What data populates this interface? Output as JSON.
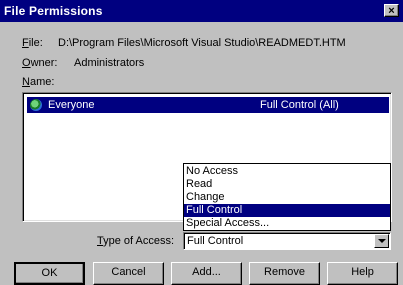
{
  "window": {
    "title": "File Permissions",
    "close_glyph": "×"
  },
  "file": {
    "label_accel": "F",
    "label_rest": "ile:",
    "value": "D:\\Program Files\\Microsoft Visual Studio\\READMEDT.HTM"
  },
  "owner": {
    "label_accel": "O",
    "label_rest": "wner:",
    "value": "Administrators"
  },
  "name": {
    "label_accel": "N",
    "label_rest": "ame:"
  },
  "permissions_list": [
    {
      "name": "Everyone",
      "permission": "Full Control (All)",
      "icon": "globe-icon",
      "selected": true
    }
  ],
  "type_of_access": {
    "label_accel": "T",
    "label_rest": "ype of Access:",
    "selected": "Full Control",
    "options": [
      "No Access",
      "Read",
      "Change",
      "Full Control",
      "Special Access..."
    ],
    "selected_index": 3
  },
  "buttons": [
    "OK",
    "Cancel",
    "Add...",
    "Remove",
    "Help"
  ]
}
